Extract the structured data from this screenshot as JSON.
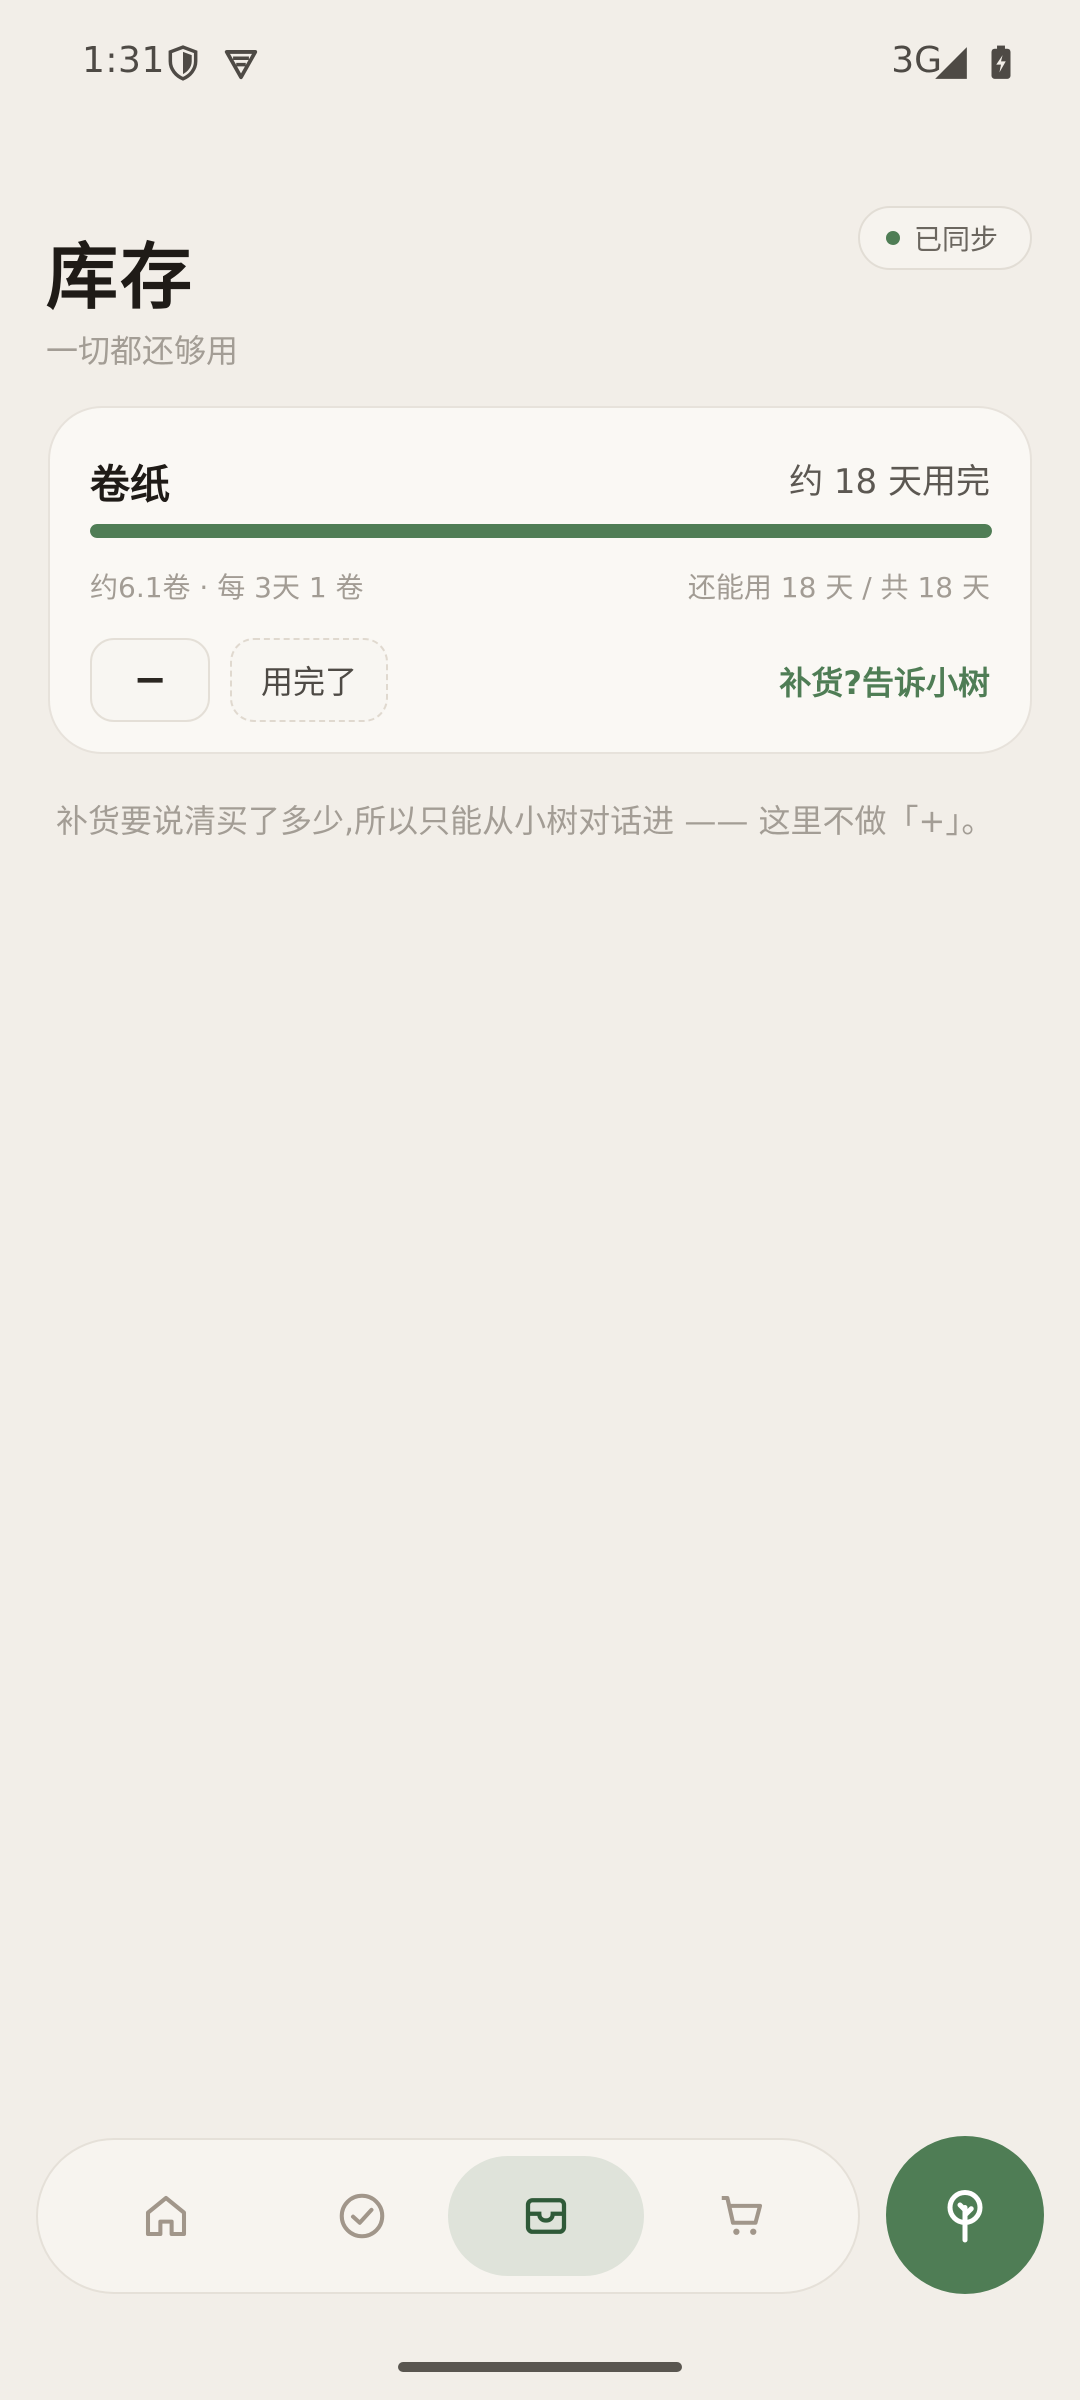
{
  "status_bar": {
    "time": "1:31",
    "network": "3G",
    "icons": [
      "shield-icon",
      "vpn-key-icon",
      "cell-signal-icon",
      "battery-charging-icon"
    ]
  },
  "header": {
    "title": "库存",
    "subtitle": "一切都还够用",
    "sync_status": "已同步"
  },
  "items": [
    {
      "name": "卷纸",
      "eta": "约 18 天用完",
      "progress_fraction": 1.0,
      "rate": "约6.1卷 · 每 3天 1 卷",
      "remaining": "还能用 18 天 / 共 18 天",
      "minus_label": "−",
      "used_up_label": "用完了",
      "restock_link": "补货?告诉小树"
    }
  ],
  "note": "补货要说清买了多少,所以只能从小树对话进 —— 这里不做「+」。",
  "bottom_nav": {
    "items": [
      {
        "icon": "home-icon",
        "active": false
      },
      {
        "icon": "check-circle-icon",
        "active": false
      },
      {
        "icon": "inventory-tray-icon",
        "active": true
      },
      {
        "icon": "cart-icon",
        "active": false
      }
    ]
  },
  "fab": {
    "icon": "tree-icon"
  },
  "colors": {
    "background": "#f2eee8",
    "accent": "#4f7d55",
    "muted_text": "#a39d95"
  }
}
